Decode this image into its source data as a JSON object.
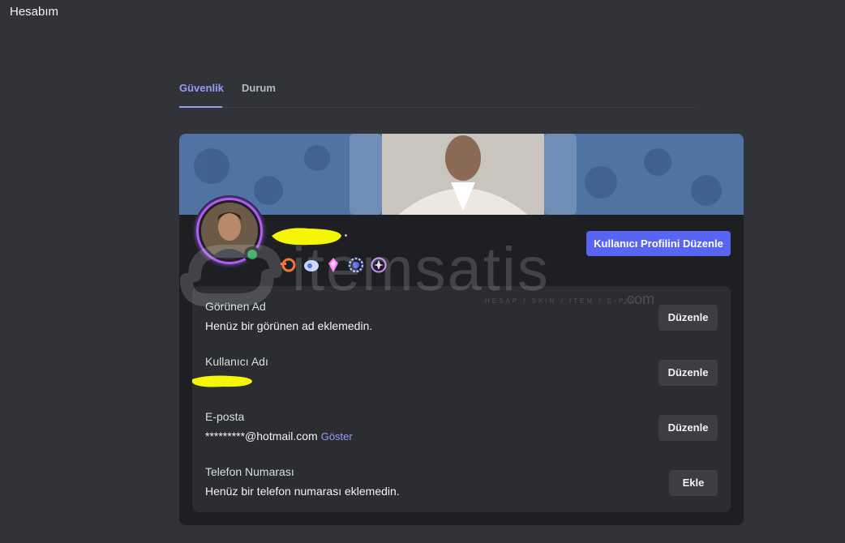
{
  "app": {
    "title": "Hesabım"
  },
  "tabs": [
    {
      "label": "Güvenlik",
      "active": true
    },
    {
      "label": "Durum",
      "active": false
    }
  ],
  "profile": {
    "status": "online",
    "badges": [
      "hypesquad-balance-icon",
      "nitro-icon",
      "boost-gem-icon",
      "early-supporter-laurel-icon",
      "quest-icon"
    ],
    "edit_button": "Kullanıcı Profilini Düzenle",
    "accent_color": "#5865f2",
    "status_color": "#23a55a"
  },
  "fields": [
    {
      "label": "Görünen Ad",
      "value": "Henüz bir görünen ad eklemedin.",
      "button": "Düzenle"
    },
    {
      "label": "Kullanıcı Adı",
      "value": "",
      "button": "Düzenle"
    },
    {
      "label": "E-posta",
      "value": "*********@hotmail.com",
      "reveal": "Göster",
      "button": "Düzenle"
    },
    {
      "label": "Telefon Numarası",
      "value": "Henüz bir telefon numarası eklemedin.",
      "button": "Ekle"
    }
  ],
  "watermark": {
    "brand": "itemsatis",
    "tagline": "HESAP / SKIN / ITEM / E-PIN",
    "suffix": ".com"
  }
}
